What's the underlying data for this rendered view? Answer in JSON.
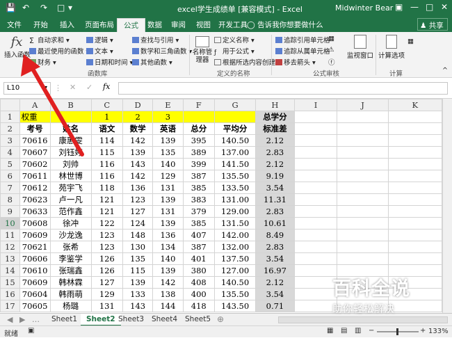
{
  "titlebar": {
    "title": "excel学生成绩单 [兼容模式] - Excel",
    "user": "Midwinter Bear",
    "undo_icon": "undo-icon",
    "redo_icon": "redo-icon"
  },
  "tabs": [
    "文件",
    "开始",
    "插入",
    "页面布局",
    "公式",
    "数据",
    "审阅",
    "视图",
    "开发工具"
  ],
  "active_tab": "公式",
  "tell_me": "告诉我你想要做什么",
  "share": "共享",
  "ribbon": {
    "insert_function": "插入函数",
    "autosum": "自动求和",
    "recent": "最近使用的函数",
    "financial": "财务",
    "logical": "逻辑",
    "text": "文本",
    "datetime": "日期和时间",
    "lookup": "查找与引用",
    "math": "数学和三角函数",
    "other": "其他函数",
    "group_library": "函数库",
    "name_manager": "名称管理器",
    "define_name": "定义名称",
    "use_in_formula": "用于公式",
    "create_from_sel": "根据所选内容创建",
    "group_names": "定义的名称",
    "trace_precedents": "追踪引用单元格",
    "trace_dependents": "追踪从属单元格",
    "remove_arrows": "移去箭头",
    "group_audit": "公式审核",
    "watch_window": "监视窗口",
    "calc_options": "计算选项",
    "group_calc": "计算"
  },
  "formula_bar": {
    "name_box": "L10",
    "fx": "fx",
    "formula": ""
  },
  "columns": [
    "A",
    "B",
    "C",
    "D",
    "E",
    "F",
    "G",
    "H",
    "I",
    "J",
    "K"
  ],
  "rows": [
    {
      "n": "1",
      "cells": [
        "权重",
        "",
        "1",
        "2",
        "3",
        "",
        "",
        "总学分"
      ]
    },
    {
      "n": "2",
      "cells": [
        "考号",
        "姓名",
        "语文",
        "数学",
        "英语",
        "总分",
        "平均分",
        "标准差"
      ]
    },
    {
      "n": "3",
      "cells": [
        "70616",
        "康惠雯",
        "114",
        "142",
        "139",
        "395",
        "140.50",
        "2.12"
      ]
    },
    {
      "n": "4",
      "cells": [
        "70607",
        "刘钰婷",
        "115",
        "139",
        "135",
        "389",
        "137.00",
        "2.83"
      ]
    },
    {
      "n": "5",
      "cells": [
        "70602",
        "刘帅",
        "116",
        "143",
        "140",
        "399",
        "141.50",
        "2.12"
      ]
    },
    {
      "n": "6",
      "cells": [
        "70611",
        "林世博",
        "116",
        "142",
        "129",
        "387",
        "135.50",
        "9.19"
      ]
    },
    {
      "n": "7",
      "cells": [
        "70612",
        "苑宇飞",
        "118",
        "136",
        "131",
        "385",
        "133.50",
        "3.54"
      ]
    },
    {
      "n": "8",
      "cells": [
        "70623",
        "卢一凡",
        "121",
        "123",
        "139",
        "383",
        "131.00",
        "11.31"
      ]
    },
    {
      "n": "9",
      "cells": [
        "70633",
        "范作鑫",
        "121",
        "127",
        "131",
        "379",
        "129.00",
        "2.83"
      ]
    },
    {
      "n": "10",
      "cells": [
        "70608",
        "徐冲",
        "122",
        "124",
        "139",
        "385",
        "131.50",
        "10.61"
      ]
    },
    {
      "n": "11",
      "cells": [
        "70609",
        "沙龙逸",
        "123",
        "148",
        "136",
        "407",
        "142.00",
        "8.49"
      ]
    },
    {
      "n": "12",
      "cells": [
        "70621",
        "张希",
        "123",
        "130",
        "134",
        "387",
        "132.00",
        "2.83"
      ]
    },
    {
      "n": "13",
      "cells": [
        "70606",
        "李鉴学",
        "126",
        "135",
        "140",
        "401",
        "137.50",
        "3.54"
      ]
    },
    {
      "n": "14",
      "cells": [
        "70610",
        "张瑞鑫",
        "126",
        "115",
        "139",
        "380",
        "127.00",
        "16.97"
      ]
    },
    {
      "n": "15",
      "cells": [
        "70609",
        "韩林霖",
        "127",
        "139",
        "142",
        "408",
        "140.50",
        "2.12"
      ]
    },
    {
      "n": "16",
      "cells": [
        "70604",
        "韩雨萌",
        "129",
        "133",
        "138",
        "400",
        "135.50",
        "3.54"
      ]
    },
    {
      "n": "17",
      "cells": [
        "70605",
        "杨璐",
        "131",
        "143",
        "144",
        "418",
        "143.50",
        "0.71"
      ]
    }
  ],
  "sheets": [
    "Sheet1",
    "Sheet2",
    "Sheet3",
    "Sheet4",
    "Sheet5"
  ],
  "active_sheet": "Sheet2",
  "status": {
    "ready": "就绪",
    "zoom": "133%"
  },
  "watermark": {
    "big": "百科全说",
    "small": "助你轻松解决"
  },
  "colors": {
    "excel_green": "#217346",
    "highlight_yellow": "#ffff00",
    "selection_gray": "#d8d8d8",
    "arrow_red": "#e02020"
  }
}
